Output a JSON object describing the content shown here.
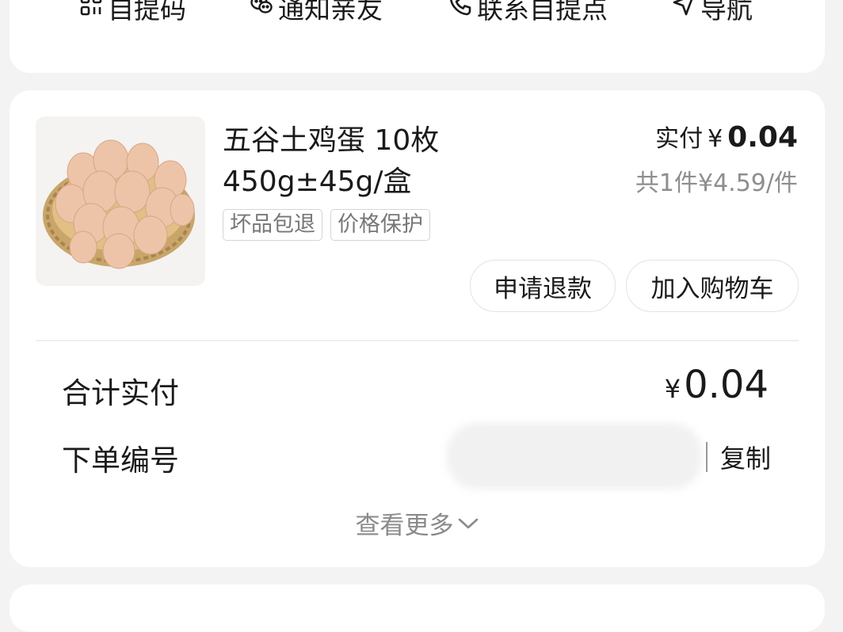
{
  "top_actions": [
    {
      "label": "自提码",
      "icon": "qr-code-icon"
    },
    {
      "label": "通知亲友",
      "icon": "wechat-icon"
    },
    {
      "label": "联系自提点",
      "icon": "phone-icon"
    },
    {
      "label": "导航",
      "icon": "navigation-arrow-icon"
    }
  ],
  "product": {
    "title": "五谷土鸡蛋 10枚 450g±45g/盒",
    "tags": [
      "坏品包退",
      "价格保护"
    ],
    "paid_label": "实付",
    "paid_currency": "¥",
    "paid_value": "0.04",
    "qty_text": "共1件¥4.59/件",
    "image_icon": "egg-basket-image"
  },
  "buttons": {
    "refund": "申请退款",
    "add_to_cart": "加入购物车"
  },
  "summary": {
    "total_label": "合计实付",
    "total_currency": "¥",
    "total_value": "0.04",
    "order_no_label": "下单编号",
    "copy_label": "复制",
    "view_more": "查看更多"
  },
  "colors": {
    "background": "#f3f3f3",
    "card": "#ffffff",
    "muted_text": "#8e8e8e",
    "tag_border": "#d5d5d5"
  }
}
